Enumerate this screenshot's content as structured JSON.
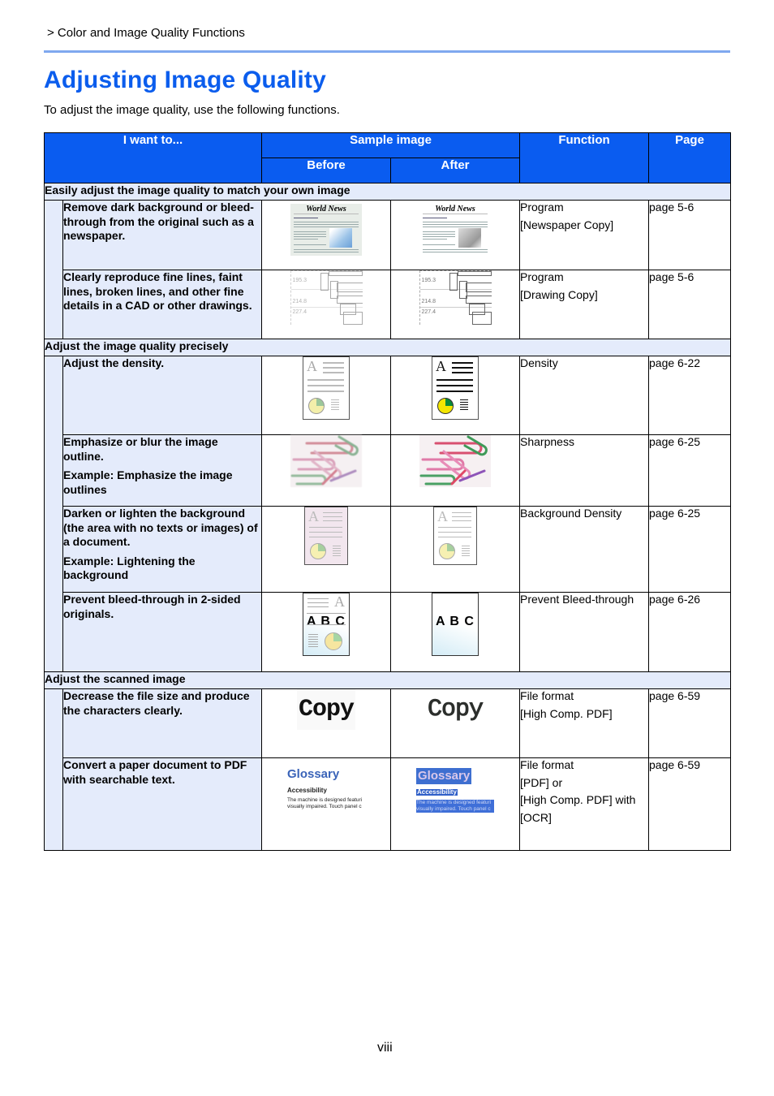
{
  "breadcrumb": "> Color and Image Quality Functions",
  "title": "Adjusting Image Quality",
  "intro": "To adjust the image quality, use the following functions.",
  "colors": {
    "accent": "#0b5ded",
    "header_bg": "#0a5cf0",
    "section_bg": "#e4ebfb",
    "rule": "#7fa8ef"
  },
  "table": {
    "headers": {
      "want": "I want to...",
      "sample": "Sample image",
      "before": "Before",
      "after": "After",
      "function": "Function",
      "page": "Page"
    },
    "sections": [
      {
        "title": "Easily adjust the image quality to match your own image",
        "rows": [
          {
            "want": [
              "Remove dark background or bleed-through from the original such as a newspaper."
            ],
            "sample": "newspaper",
            "sample_text": "World News",
            "function": [
              "Program",
              "[Newspaper Copy]"
            ],
            "page": "page 5-6"
          },
          {
            "want": [
              "Clearly reproduce fine lines, faint lines, broken lines, and other fine details in a CAD or other drawings."
            ],
            "sample": "cad-drawing",
            "sample_labels": [
              "195.3",
              "214.8",
              "227.4"
            ],
            "function": [
              "Program",
              "[Drawing Copy]"
            ],
            "page": "page 5-6"
          }
        ]
      },
      {
        "title": "Adjust the image quality precisely",
        "rows": [
          {
            "want": [
              "Adjust the density."
            ],
            "sample": "document-density",
            "function": [
              "Density"
            ],
            "page": "page 6-22"
          },
          {
            "want": [
              "Emphasize or blur the image outline.",
              "Example: Emphasize the image outlines"
            ],
            "sample": "paper-clips",
            "function": [
              "Sharpness"
            ],
            "page": "page 6-25"
          },
          {
            "want": [
              "Darken or lighten the background (the area with no texts or images) of a document.",
              "Example: Lightening the background"
            ],
            "sample": "document-background",
            "function": [
              "Background Density"
            ],
            "page": "page 6-25"
          },
          {
            "want": [
              "Prevent bleed-through in 2-sided originals."
            ],
            "sample": "abc-bleed-through",
            "sample_text": "A B C",
            "function": [
              "Prevent Bleed-through"
            ],
            "page": "page 6-26"
          }
        ]
      },
      {
        "title": "Adjust the scanned image",
        "rows": [
          {
            "want": [
              "Decrease the file size and produce the characters clearly."
            ],
            "sample": "copy-text",
            "sample_text": "Copy",
            "function": [
              "File format",
              "[High Comp. PDF]"
            ],
            "page": "page 6-59"
          },
          {
            "want": [
              "Convert a paper document to PDF with searchable text."
            ],
            "sample": "glossary-ocr",
            "sample_text": {
              "heading": "Glossary",
              "sub": "Accessibility",
              "body1": "The machine is designed featuri",
              "body2": "visually impaired. Touch panel c"
            },
            "function": [
              "File format",
              "[PDF] or",
              "[High Comp. PDF] with",
              "[OCR]"
            ],
            "page": "page 6-59"
          }
        ]
      }
    ]
  },
  "page_number": "viii"
}
